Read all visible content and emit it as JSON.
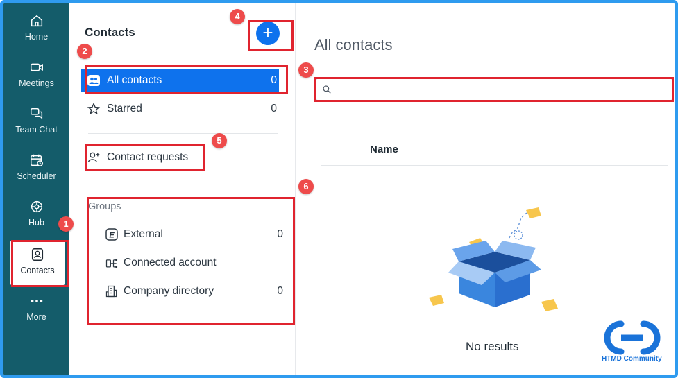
{
  "rail": {
    "items": [
      {
        "label": "Home",
        "icon": "home-icon"
      },
      {
        "label": "Meetings",
        "icon": "video-camera-icon"
      },
      {
        "label": "Team Chat",
        "icon": "chat-bubbles-icon"
      },
      {
        "label": "Scheduler",
        "icon": "calendar-clock-icon"
      },
      {
        "label": "Hub",
        "icon": "hub-icon"
      },
      {
        "label": "Contacts",
        "icon": "contact-card-icon"
      },
      {
        "label": "More",
        "icon": "more-dots-icon"
      }
    ]
  },
  "panel": {
    "title": "Contacts",
    "add_button": "+",
    "all_contacts": {
      "label": "All contacts",
      "count": "0"
    },
    "starred": {
      "label": "Starred",
      "count": "0"
    },
    "contact_requests": {
      "label": "Contact requests"
    },
    "groups_heading": "Groups",
    "groups": [
      {
        "label": "External",
        "count": "0",
        "icon": "external-badge-icon",
        "badge_letter": "E"
      },
      {
        "label": "Connected account",
        "count": "",
        "icon": "connected-account-icon"
      },
      {
        "label": "Company directory",
        "count": "0",
        "icon": "building-icon"
      }
    ]
  },
  "main": {
    "title": "All contacts",
    "search_value": "",
    "column_header": "Name",
    "empty_text": "No results"
  },
  "annotations": [
    "1",
    "2",
    "3",
    "4",
    "5",
    "6"
  ],
  "watermark": {
    "text": "HTMD Community"
  },
  "colors": {
    "rail_bg": "#145c6a",
    "accent": "#0e72ed",
    "annotation_red": "#e0242f",
    "frame_blue": "#2f9bef"
  }
}
